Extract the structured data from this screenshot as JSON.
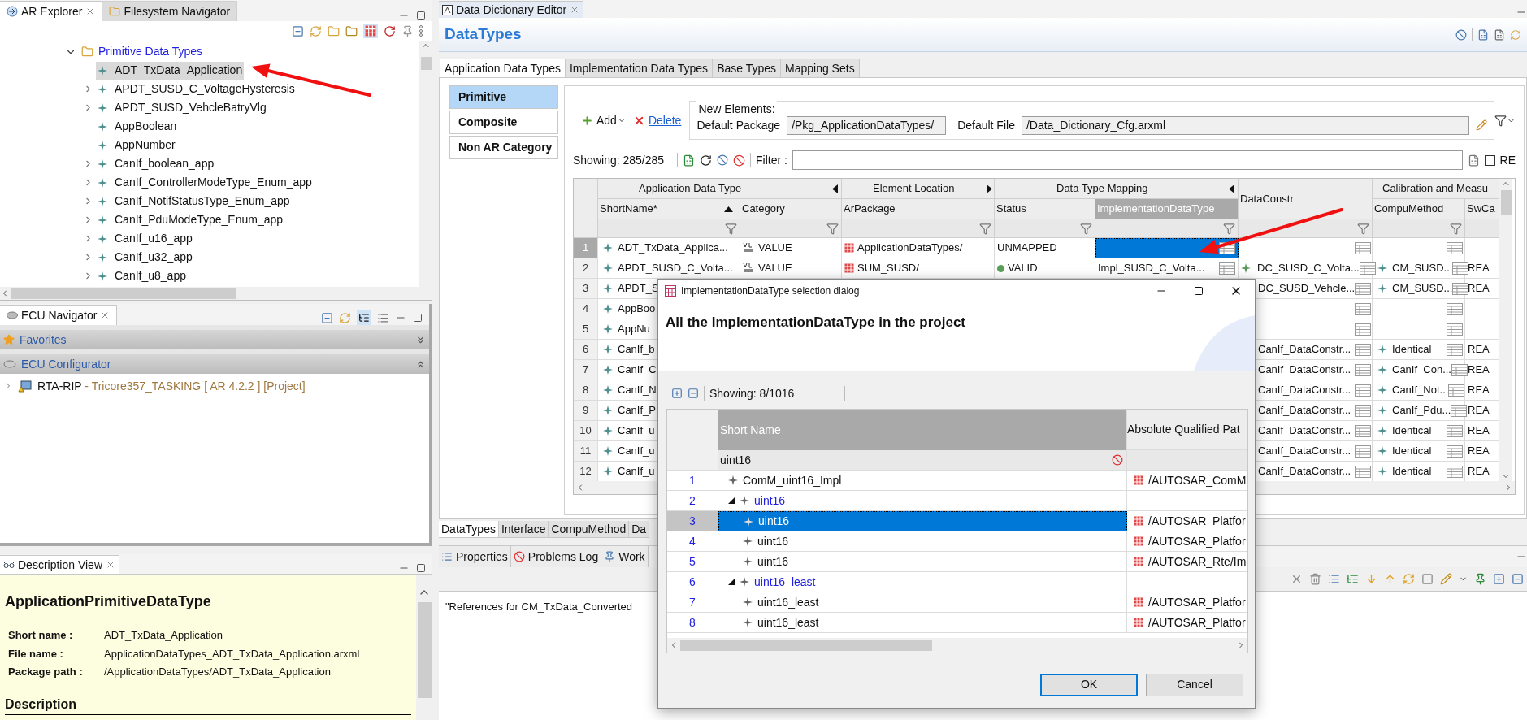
{
  "explorer": {
    "tabs": [
      {
        "label": "AR Explorer",
        "selected": true
      },
      {
        "label": "Filesystem Navigator",
        "selected": false
      }
    ],
    "tree": [
      {
        "label": "Primitive Data Types",
        "expanded": true,
        "children": [
          {
            "label": "ADT_TxData_Application",
            "selected": true,
            "expandable": false
          },
          {
            "label": "APDT_SUSD_C_VoltageHysteresis",
            "selected": false,
            "expandable": true
          },
          {
            "label": "APDT_SUSD_VehcleBatryVlg",
            "selected": false,
            "expandable": true
          },
          {
            "label": "AppBoolean",
            "selected": false,
            "expandable": false
          },
          {
            "label": "AppNumber",
            "selected": false,
            "expandable": false
          },
          {
            "label": "CanIf_boolean_app",
            "selected": false,
            "expandable": true
          },
          {
            "label": "CanIf_ControllerModeType_Enum_app",
            "selected": false,
            "expandable": true
          },
          {
            "label": "CanIf_NotifStatusType_Enum_app",
            "selected": false,
            "expandable": true
          },
          {
            "label": "CanIf_PduModeType_Enum_app",
            "selected": false,
            "expandable": true
          },
          {
            "label": "CanIf_u16_app",
            "selected": false,
            "expandable": true
          },
          {
            "label": "CanIf_u32_app",
            "selected": false,
            "expandable": true
          },
          {
            "label": "CanIf_u8_app",
            "selected": false,
            "expandable": true
          }
        ]
      }
    ]
  },
  "ecu_navigator": {
    "title": "ECU Navigator",
    "sections": [
      {
        "label": "Favorites",
        "expanded": false
      },
      {
        "label": "ECU Configurator",
        "expanded": true
      }
    ],
    "projects": [
      {
        "name": "RTA-RIP",
        "detail": "- Tricore357_TASKING [ AR 4.2.2 ] [Project]",
        "expanded": false
      }
    ]
  },
  "description_view": {
    "title": "Description View",
    "heading": "ApplicationPrimitiveDataType",
    "fields": [
      {
        "label": "Short name :",
        "value": "ADT_TxData_Application"
      },
      {
        "label": "File name :",
        "value": "ApplicationDataTypes_ADT_TxData_Application.arxml"
      },
      {
        "label": "Package path :",
        "value": "/ApplicationDataTypes/ADT_TxData_Application"
      }
    ],
    "section": "Description"
  },
  "editor": {
    "tab": "Data Dictionary Editor",
    "title": "DataTypes",
    "tabs": [
      {
        "label": "Application Data Types",
        "selected": true
      },
      {
        "label": "Implementation Data Types",
        "selected": false
      },
      {
        "label": "Base Types",
        "selected": false
      },
      {
        "label": "Mapping Sets",
        "selected": false
      }
    ],
    "categories": [
      {
        "label": "Primitive",
        "selected": true
      },
      {
        "label": "Composite",
        "selected": false
      },
      {
        "label": "Non AR Category",
        "selected": false
      }
    ],
    "add_label": "Add",
    "delete_label": "Delete",
    "new_elements": {
      "legend": "New Elements:",
      "package_label": "Default Package",
      "package_value": "/Pkg_ApplicationDataTypes/",
      "file_label": "Default File",
      "file_value": "/Data_Dictionary_Cfg.arxml"
    },
    "showing": "Showing: 285/285",
    "filter_label": "Filter :",
    "re": {
      "label": "RE",
      "checked": false
    },
    "table": {
      "groups": [
        "Application Data Type",
        "Element Location",
        "Data Type Mapping",
        "Calibration and Measu"
      ],
      "columns": [
        "ShortName*",
        "Category",
        "ArPackage",
        "Status",
        "ImplementationDataType",
        "DataConstr",
        "CompuMethod",
        "SwCa"
      ],
      "rows": [
        {
          "number": "1",
          "selected": true,
          "short_name": "ADT_TxData_Applica...",
          "category": "VALUE",
          "ar_package": "ApplicationDataTypes/",
          "status": "UNMAPPED",
          "mapped": false,
          "impl_selected": true
        },
        {
          "number": "2",
          "selected": false,
          "short_name": "APDT_SUSD_C_Volta...",
          "category": "VALUE",
          "ar_package": "SUM_SUSD/",
          "status": "VALID",
          "mapped": true,
          "impl_selected": false,
          "impl_type": "Impl_SUSD_C_Volta...",
          "data_constr": "DC_SUSD_C_Volta...",
          "compu_method": "CM_SUSD...",
          "sw_ca": "REA"
        },
        {
          "number": "3",
          "selected": false,
          "short_name": "APDT_S",
          "data_constr": "DC_SUSD_Vehcle...",
          "compu_method": "CM_SUSD...",
          "sw_ca": "REA"
        },
        {
          "number": "4",
          "selected": false,
          "short_name": "AppBoo"
        },
        {
          "number": "5",
          "selected": false,
          "short_name": "AppNu"
        },
        {
          "number": "6",
          "selected": false,
          "short_name": "CanIf_b",
          "data_constr": "CanIf_DataConstr...",
          "compu_method": "Identical",
          "sw_ca": "REA"
        },
        {
          "number": "7",
          "selected": false,
          "short_name": "CanIf_C",
          "data_constr": "CanIf_DataConstr...",
          "compu_method": "CanIf_Con...",
          "sw_ca": "REA"
        },
        {
          "number": "8",
          "selected": false,
          "short_name": "CanIf_N",
          "data_constr": "CanIf_DataConstr...",
          "compu_method": "CanIf_Not...",
          "sw_ca": "REA"
        },
        {
          "number": "9",
          "selected": false,
          "short_name": "CanIf_P",
          "data_constr": "CanIf_DataConstr...",
          "compu_method": "CanIf_Pdu...",
          "sw_ca": "REA"
        },
        {
          "number": "10",
          "selected": false,
          "short_name": "CanIf_u",
          "data_constr": "CanIf_DataConstr...",
          "compu_method": "Identical",
          "sw_ca": "REA"
        },
        {
          "number": "11",
          "selected": false,
          "short_name": "CanIf_u",
          "data_constr": "CanIf_DataConstr...",
          "compu_method": "Identical",
          "sw_ca": "REA"
        },
        {
          "number": "12",
          "selected": false,
          "short_name": "CanIf_u",
          "data_constr": "CanIf_DataConstr...",
          "compu_method": "Identical",
          "sw_ca": "REA"
        }
      ]
    },
    "bottom_tabs": [
      {
        "label": "DataTypes",
        "selected": true
      },
      {
        "label": "Interface",
        "selected": false
      },
      {
        "label": "CompuMethod",
        "selected": false
      },
      {
        "label": "Da",
        "selected": false
      }
    ]
  },
  "properties": {
    "tabs": [
      {
        "label": "Properties",
        "selected": false
      },
      {
        "label": "Problems Log",
        "selected": false
      },
      {
        "label": "Work",
        "selected": false
      }
    ],
    "text": "\"References for CM_TxData_Converted"
  },
  "dialog": {
    "title": "ImplementationDataType selection dialog",
    "heading": "All the ImplementationDataType in the project",
    "showing": "Showing: 8/1016",
    "columns": [
      "Short Name",
      "Absolute Qualified Pat"
    ],
    "filter": "uint16",
    "rows": [
      {
        "number": "1",
        "name": "ComM_uint16_Impl",
        "path": "/AUTOSAR_ComM",
        "selected": false
      },
      {
        "number": "2",
        "name": "uint16",
        "selected": false,
        "expanded": true,
        "children": [
          {
            "number": "3",
            "name": "uint16",
            "path": "/AUTOSAR_Platfor",
            "selected": true
          },
          {
            "number": "4",
            "name": "uint16",
            "path": "/AUTOSAR_Platfor",
            "selected": false
          },
          {
            "number": "5",
            "name": "uint16",
            "path": "/AUTOSAR_Rte/Im",
            "selected": false
          }
        ]
      },
      {
        "number": "6",
        "name": "uint16_least",
        "selected": false,
        "expanded": true,
        "children": [
          {
            "number": "7",
            "name": "uint16_least",
            "path": "/AUTOSAR_Platfor",
            "selected": false
          },
          {
            "number": "8",
            "name": "uint16_least",
            "path": "/AUTOSAR_Platfor",
            "selected": false
          }
        ]
      }
    ],
    "buttons": [
      {
        "label": "OK",
        "default": true
      },
      {
        "label": "Cancel",
        "default": false
      }
    ]
  }
}
